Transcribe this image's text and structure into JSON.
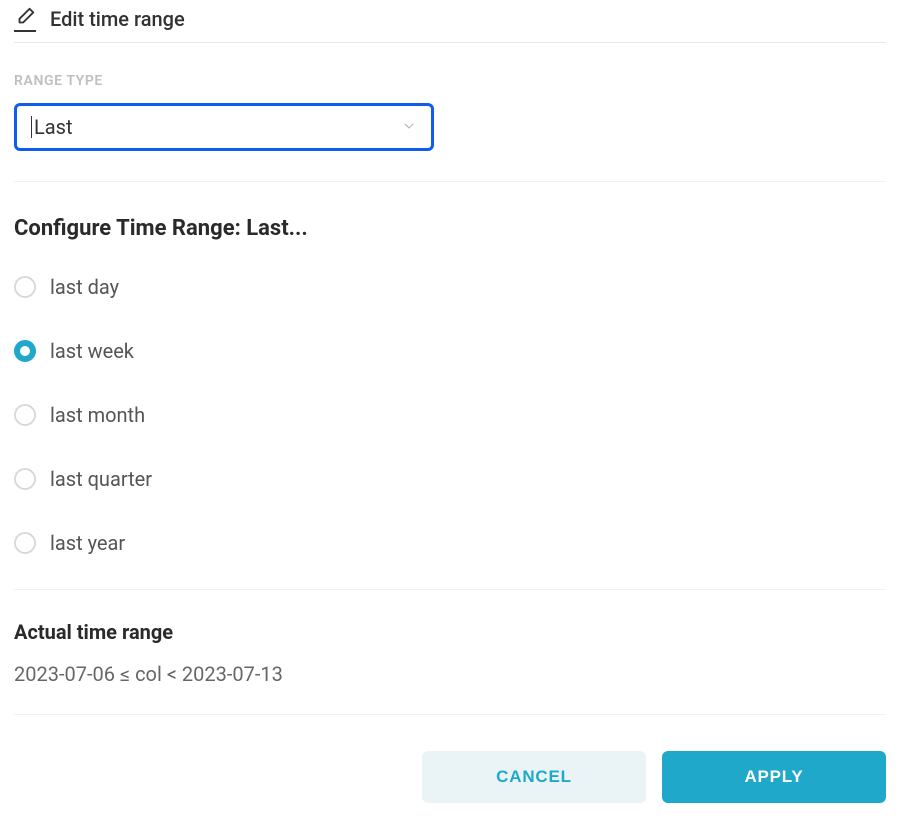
{
  "header": {
    "title": "Edit time range",
    "icon": "pencil-icon"
  },
  "rangeType": {
    "label": "RANGE TYPE",
    "value": "Last"
  },
  "configure": {
    "title": "Configure Time Range: Last...",
    "options": [
      {
        "label": "last day",
        "selected": false
      },
      {
        "label": "last week",
        "selected": true
      },
      {
        "label": "last month",
        "selected": false
      },
      {
        "label": "last quarter",
        "selected": false
      },
      {
        "label": "last year",
        "selected": false
      }
    ]
  },
  "actual": {
    "title": "Actual time range",
    "value": "2023-07-06 ≤ col < 2023-07-13"
  },
  "footer": {
    "cancel": "CANCEL",
    "apply": "APPLY"
  }
}
